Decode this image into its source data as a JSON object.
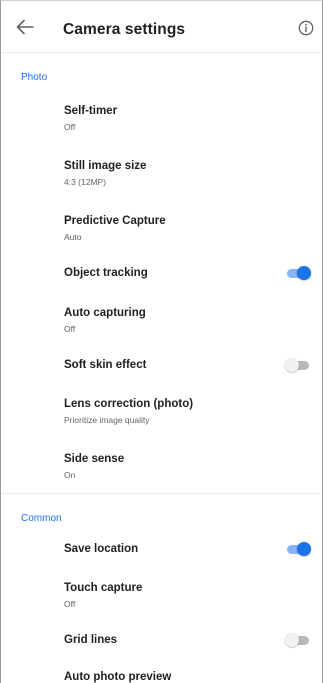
{
  "appbar": {
    "title": "Camera settings",
    "back_icon": "arrow-left-icon",
    "info_icon": "info-circle-icon"
  },
  "sections": {
    "photo": "Photo",
    "common": "Common"
  },
  "items": {
    "self_timer": {
      "title": "Self-timer",
      "value": "Off"
    },
    "still_image_size": {
      "title": "Still image size",
      "value": "4:3 (12MP)"
    },
    "predictive_capture": {
      "title": "Predictive Capture",
      "value": "Auto"
    },
    "object_tracking": {
      "title": "Object tracking",
      "enabled": true
    },
    "auto_capturing": {
      "title": "Auto capturing",
      "value": "Off"
    },
    "soft_skin_effect": {
      "title": "Soft skin effect",
      "enabled": false
    },
    "lens_correction": {
      "title": "Lens correction (photo)",
      "value": "Prioritize image quality"
    },
    "side_sense": {
      "title": "Side sense",
      "value": "On"
    },
    "save_location": {
      "title": "Save location",
      "enabled": true
    },
    "touch_capture": {
      "title": "Touch capture",
      "value": "Off"
    },
    "grid_lines": {
      "title": "Grid lines",
      "enabled": false
    },
    "auto_photo_preview": {
      "title": "Auto photo preview"
    }
  },
  "colors": {
    "accent": "#1a73e8",
    "accent_track": "#8ab4f8",
    "toggle_off_track": "#b9b9b9",
    "toggle_off_knob": "#f1f1f1"
  }
}
